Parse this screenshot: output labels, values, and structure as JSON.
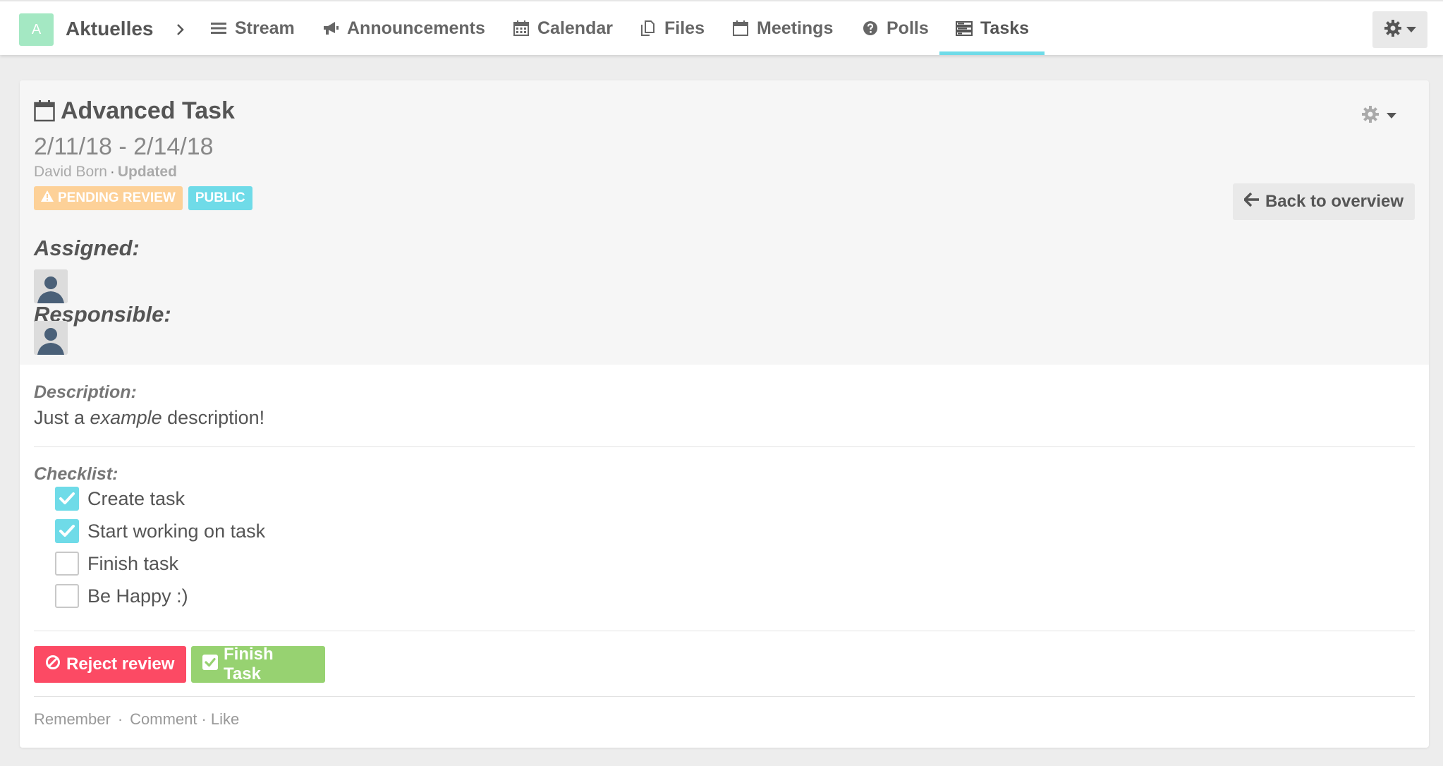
{
  "nav": {
    "space_initial": "A",
    "space_name": "Aktuelles",
    "items": [
      {
        "label": "Stream",
        "icon": "bars-icon"
      },
      {
        "label": "Announcements",
        "icon": "bullhorn-icon"
      },
      {
        "label": "Calendar",
        "icon": "calendar-icon"
      },
      {
        "label": "Files",
        "icon": "files-icon"
      },
      {
        "label": "Meetings",
        "icon": "calendar-empty-icon"
      },
      {
        "label": "Polls",
        "icon": "question-circle-icon"
      },
      {
        "label": "Tasks",
        "icon": "tasks-icon",
        "active": true
      }
    ],
    "accent_color": "#6fdbe8"
  },
  "task": {
    "title": "Advanced Task",
    "dates": "2/11/18 - 2/14/18",
    "author": "David Born",
    "separator": "·",
    "updated": "Updated",
    "badges": {
      "pending": "PENDING REVIEW",
      "public": "PUBLIC"
    },
    "assigned_label": "Assigned:",
    "responsible_label": "Responsible:",
    "back_label": "Back to overview"
  },
  "description": {
    "label": "Description:",
    "text_before": "Just a ",
    "text_em": "example",
    "text_after": " description!"
  },
  "checklist": {
    "label": "Checklist:",
    "items": [
      {
        "text": "Create task",
        "checked": true
      },
      {
        "text": "Start working on task",
        "checked": true
      },
      {
        "text": "Finish task",
        "checked": false
      },
      {
        "text": "Be Happy :)",
        "checked": false
      }
    ]
  },
  "actions": {
    "reject": "Reject review",
    "finish": "Finish Task",
    "reject_color": "#fc4a64",
    "finish_color": "#97d271"
  },
  "footer": {
    "remember": "Remember",
    "comment": "Comment",
    "like": "Like",
    "sep": "·"
  }
}
